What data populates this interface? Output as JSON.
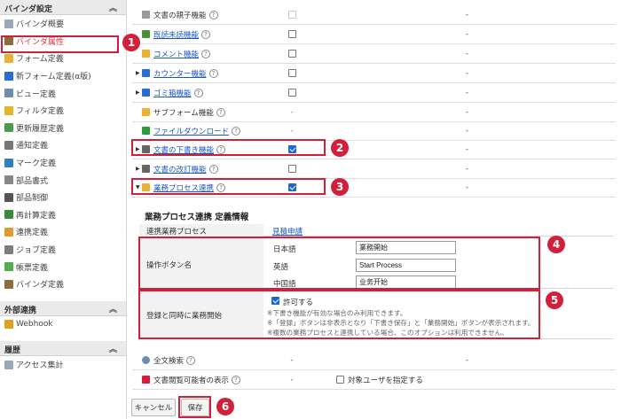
{
  "sidebar": {
    "sections": [
      {
        "title": "バインダ設定",
        "items": [
          {
            "label": "バインダ概要",
            "icon": "document-icon",
            "color": "#9aa7b8"
          },
          {
            "label": "バインダ属性",
            "icon": "gear-icon",
            "color": "#8a6d3b",
            "active": true
          },
          {
            "label": "フォーム定義",
            "icon": "form-icon",
            "color": "#e9b233"
          },
          {
            "label": "新フォーム定義(α版)",
            "icon": "new-form-icon",
            "color": "#2a6cd6"
          },
          {
            "label": "ビュー定義",
            "icon": "view-icon",
            "color": "#6d8cae"
          },
          {
            "label": "フィルタ定義",
            "icon": "filter-icon",
            "color": "#e7b52a"
          },
          {
            "label": "更新履歴定義",
            "icon": "history-icon",
            "color": "#4e9a4e"
          },
          {
            "label": "通知定義",
            "icon": "notify-icon",
            "color": "#777777"
          },
          {
            "label": "マーク定義",
            "icon": "mark-icon",
            "color": "#2d7fc1"
          },
          {
            "label": "部品書式",
            "icon": "parts-format-icon",
            "color": "#888888"
          },
          {
            "label": "部品制御",
            "icon": "parts-control-icon",
            "color": "#555555"
          },
          {
            "label": "再計算定義",
            "icon": "recalc-icon",
            "color": "#3a8a3a"
          },
          {
            "label": "連携定義",
            "icon": "link-icon",
            "color": "#e39a2b"
          },
          {
            "label": "ジョブ定義",
            "icon": "job-icon",
            "color": "#7c7c7c"
          },
          {
            "label": "帳票定義",
            "icon": "report-icon",
            "color": "#4caf50"
          },
          {
            "label": "バインダ定義",
            "icon": "binder-icon",
            "color": "#8a6d3b"
          }
        ]
      },
      {
        "title": "外部連携",
        "items": [
          {
            "label": "Webhook",
            "icon": "webhook-icon",
            "color": "#e0a020"
          }
        ]
      },
      {
        "title": "履歴",
        "items": [
          {
            "label": "アクセス集計",
            "icon": "access-stats-icon",
            "color": "#9aa7b8"
          }
        ]
      }
    ],
    "collapse_glyph": "︽"
  },
  "table_rows": [
    {
      "label": "文書の親子機能",
      "link": false,
      "expand": false,
      "icon_color": "#9a9a9a",
      "check": "dim",
      "value": "-"
    },
    {
      "label": "既読未読機能",
      "link": true,
      "expand": false,
      "icon_color": "#4a8f3a",
      "check": "empty",
      "value": "-"
    },
    {
      "label": "コメント機能",
      "link": true,
      "expand": false,
      "icon_color": "#e9b233",
      "check": "empty",
      "value": "-"
    },
    {
      "label": "カウンター機能",
      "link": true,
      "expand": true,
      "icon_color": "#2a6cd6",
      "check": "empty",
      "value": "-"
    },
    {
      "label": "ゴミ箱機能",
      "link": true,
      "expand": true,
      "icon_color": "#2a6cd6",
      "check": "empty",
      "value": "-"
    },
    {
      "label": "サブフォーム機能",
      "link": false,
      "expand": false,
      "icon_color": "#e9b233",
      "check": "none",
      "value": "-"
    },
    {
      "label": "ファイルダウンロード",
      "link": true,
      "expand": false,
      "icon_color": "#2e9a3a",
      "check": "none",
      "value": "-"
    },
    {
      "label": "文書の下書き機能",
      "link": true,
      "expand": true,
      "icon_color": "#666666",
      "check": "checked",
      "value": "-"
    },
    {
      "label": "文書の改訂機能",
      "link": true,
      "expand": true,
      "icon_color": "#666666",
      "check": "empty",
      "value": "-"
    },
    {
      "label": "業務プロセス連携",
      "link": true,
      "expand": "open",
      "icon_color": "#e9b233",
      "check": "checked",
      "value": "-"
    }
  ],
  "definition": {
    "title": "業務プロセス連携 定義情報",
    "process_label": "連携業務プロセス",
    "process_value": "見積申請",
    "buttons_label": "操作ボタン名",
    "langs": [
      {
        "label": "日本語",
        "value": "業務開始"
      },
      {
        "label": "英語",
        "value": "Start Process"
      },
      {
        "label": "中国語",
        "value": "业务开始"
      }
    ],
    "auto_start_label": "登録と同時に業務開始",
    "allow_label": "許可する",
    "notes": [
      "※下書き機能が有効な場合のみ利用できます。",
      "※「登録」ボタンは非表示となり「下書き保存」と「業務開始」ボタンが表示されます。",
      "※複数の業務プロセスと連携している場合、このオプションは利用できません。"
    ]
  },
  "bottom_rows": [
    {
      "label": "全文検索",
      "value": "-",
      "value2": "-"
    },
    {
      "label": "文書閲覧可能者の表示",
      "value": "-",
      "option": "対象ユーザを指定する"
    }
  ],
  "footer": {
    "cancel": "キャンセル",
    "save": "保存"
  },
  "callouts": [
    "1",
    "2",
    "3",
    "4",
    "5",
    "6"
  ],
  "colors": {
    "accent": "#d3203a",
    "link": "#1a55c4",
    "check": "#1b69d4"
  }
}
